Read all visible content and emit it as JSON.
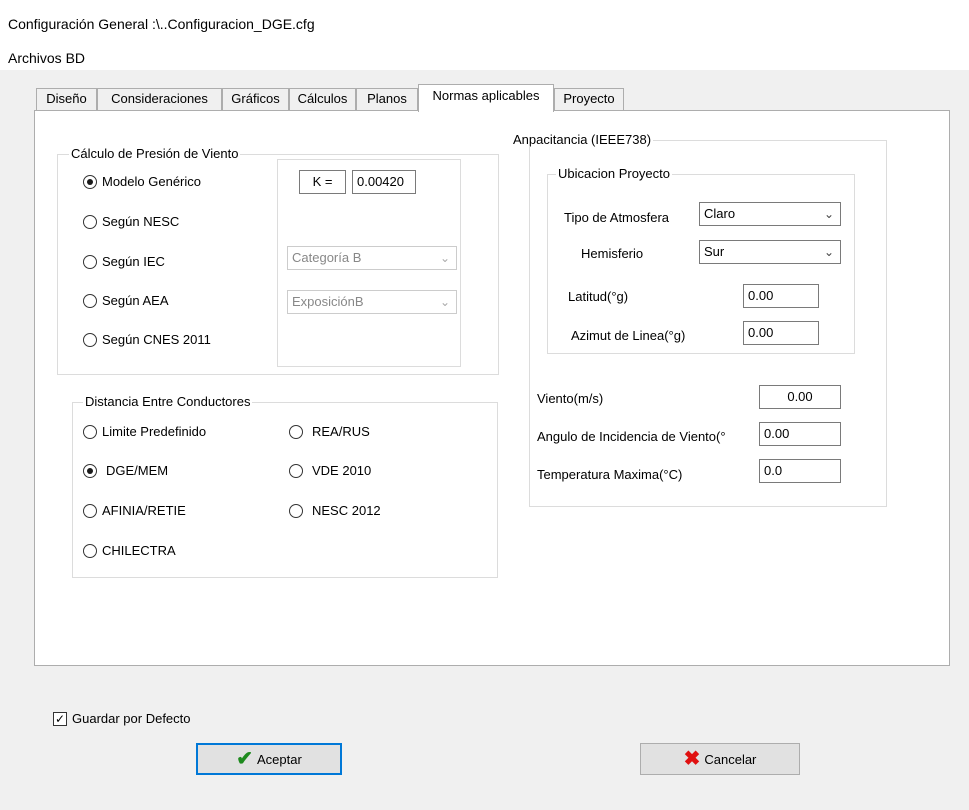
{
  "window": {
    "title": "Configuración General :\\..Configuracion_DGE.cfg"
  },
  "menu": {
    "archivos_bd": "Archivos BD"
  },
  "tabs": [
    {
      "label": "Diseño"
    },
    {
      "label": "Consideraciones"
    },
    {
      "label": "Gráficos"
    },
    {
      "label": "Cálculos"
    },
    {
      "label": "Planos"
    },
    {
      "label": "Normas aplicables"
    },
    {
      "label": "Proyecto"
    }
  ],
  "active_tab": "Normas aplicables",
  "presion_viento": {
    "legend": "Cálculo de Presión de Viento",
    "options": [
      {
        "label": "Modelo Genérico",
        "selected": true
      },
      {
        "label": "Según NESC",
        "selected": false
      },
      {
        "label": "Según IEC",
        "selected": false
      },
      {
        "label": "Según AEA",
        "selected": false
      },
      {
        "label": "Según CNES 2011",
        "selected": false
      }
    ],
    "k_label": "K =",
    "k_value": "0.00420",
    "categoria": "Categoría B",
    "exposicion": "ExposiciónB"
  },
  "distancia": {
    "legend": "Distancia Entre Conductores",
    "options": [
      {
        "label": "Limite Predefinido",
        "selected": false
      },
      {
        "label": "REA/RUS",
        "selected": false
      },
      {
        "label": "DGE/MEM",
        "selected": true
      },
      {
        "label": "VDE 2010",
        "selected": false
      },
      {
        "label": "AFINIA/RETIE",
        "selected": false
      },
      {
        "label": "NESC 2012",
        "selected": false
      },
      {
        "label": "CHILECTRA",
        "selected": false
      }
    ]
  },
  "ampacitancia": {
    "legend": "Anpacitancia (IEEE738)",
    "ubicacion": {
      "legend": "Ubicacion Proyecto",
      "tipo_atmosfera_label": "Tipo de Atmosfera",
      "tipo_atmosfera_value": "Claro",
      "hemisferio_label": "Hemisferio",
      "hemisferio_value": "Sur",
      "latitud_label": "Latitud(°g)",
      "latitud_value": "0.00",
      "azimut_label": "Azimut de Linea(°g)",
      "azimut_value": "0.00"
    },
    "viento_label": "Viento(m/s)",
    "viento_value": "0.00",
    "angulo_label": "Angulo de Incidencia de Viento(°",
    "angulo_value": "0.00",
    "temperatura_label": "Temperatura Maxima(°C)",
    "temperatura_value": "0.0"
  },
  "guardar_defecto": {
    "label": "Guardar por Defecto",
    "checked": true
  },
  "buttons": {
    "aceptar": "Aceptar",
    "cancelar": "Cancelar"
  },
  "icons": {
    "aceptar": "checkmark-icon",
    "cancelar": "x-icon",
    "dropdown": "chevron-down-icon",
    "check_color": "#1e8a1e",
    "cancel_color": "#e01010",
    "default_button_border": "#0078d7"
  }
}
